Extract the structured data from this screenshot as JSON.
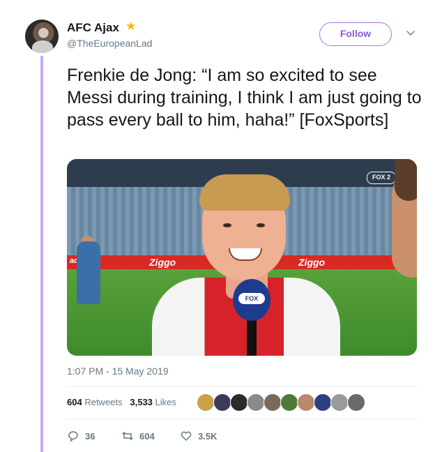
{
  "author": {
    "name": "AFC Ajax",
    "badge_icon": "shooting-star-emoji",
    "handle": "@TheEuropeanLad"
  },
  "follow_button": {
    "label": "Follow"
  },
  "tweet": {
    "text": "Frenkie de Jong: “I am so excited to see Messi during training, I think I am just going to pass every ball to him, haha!” [FoxSports]",
    "timestamp": "1:07 PM - 15 May 2019"
  },
  "media": {
    "board_text_1": "Ziggo",
    "board_text_2": "Ziggo",
    "board_text_3": "adidas",
    "mic_label": "FOX SPORTS",
    "channel_logo": "FOX 2"
  },
  "stats": {
    "retweets_count": "604",
    "retweets_label": "Retweets",
    "likes_count": "3,533",
    "likes_label": "Likes",
    "liker_avatar_colors": [
      "#c9a14a",
      "#3a3a5a",
      "#2b2b2b",
      "#8a8a8a",
      "#7a6a5a",
      "#4f7a3a",
      "#b88a6a",
      "#2f3f7f",
      "#9a9a9a",
      "#6a6a6a"
    ]
  },
  "actions": {
    "reply_count": "36",
    "retweet_count": "604",
    "like_count": "3.5K"
  },
  "colors": {
    "accent": "#8e5ad8",
    "thread_line": "#c9a8f5",
    "muted_text": "#657786"
  }
}
